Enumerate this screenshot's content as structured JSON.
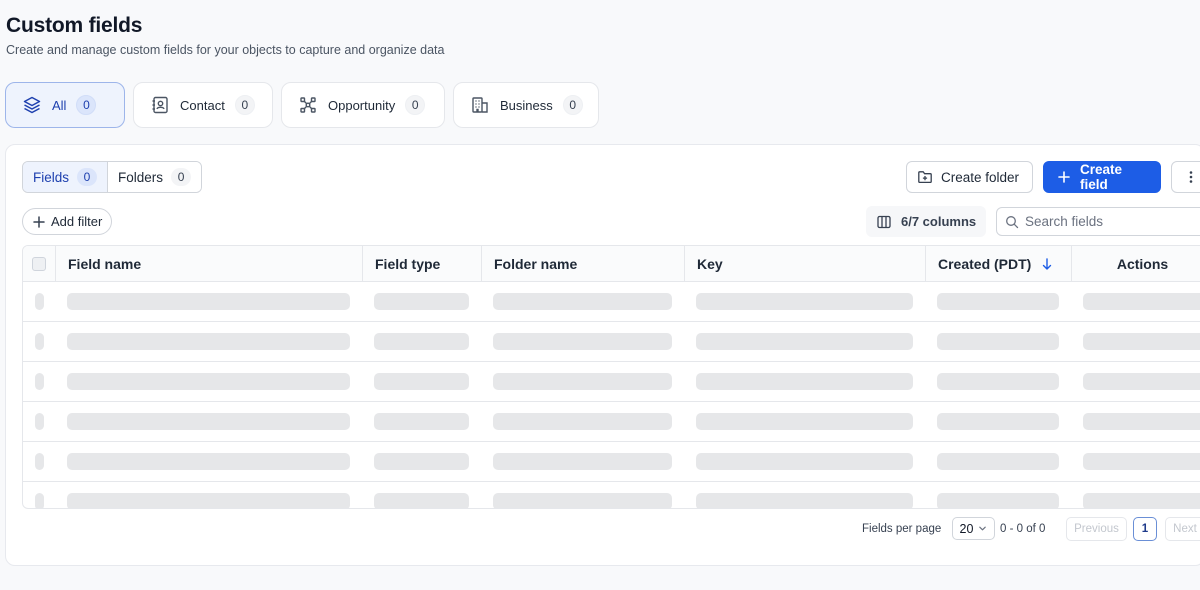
{
  "header": {
    "title": "Custom fields",
    "subtitle": "Create and manage custom fields for your objects to capture and organize data"
  },
  "object_tabs": [
    {
      "label": "All",
      "count": "0",
      "icon": "layers-icon",
      "active": true
    },
    {
      "label": "Contact",
      "count": "0",
      "icon": "contact-book-icon",
      "active": false
    },
    {
      "label": "Opportunity",
      "count": "0",
      "icon": "network-icon",
      "active": false
    },
    {
      "label": "Business",
      "count": "0",
      "icon": "building-icon",
      "active": false
    }
  ],
  "view_toggle": [
    {
      "label": "Fields",
      "count": "0",
      "active": true
    },
    {
      "label": "Folders",
      "count": "0",
      "active": false
    }
  ],
  "toolbar": {
    "create_folder_label": "Create folder",
    "create_field_label": "Create field",
    "add_filter_label": "Add filter",
    "columns_label": "6/7 columns",
    "search_placeholder": "Search fields"
  },
  "table": {
    "columns": [
      "Field name",
      "Field type",
      "Folder name",
      "Key",
      "Created (PDT)",
      "Actions"
    ],
    "sorted_column": "Created (PDT)",
    "sort_direction": "descending",
    "loading_rows": 6
  },
  "pagination": {
    "per_page_label": "Fields per page",
    "per_page_value": "20",
    "range_label": "0 - 0 of 0",
    "previous_label": "Previous",
    "current_page": "1",
    "next_label": "Next"
  },
  "colors": {
    "primary": "#1d5de6",
    "active_tab_bg": "#eef3fd",
    "skeleton": "#e6e7e9"
  }
}
